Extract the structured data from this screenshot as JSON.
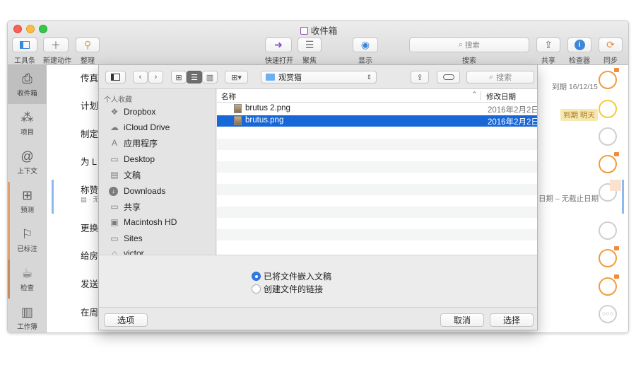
{
  "window": {
    "title": "收件箱"
  },
  "toolbar": {
    "tools_label": "工具条",
    "new_action_label": "新建动作",
    "clean_up_label": "整理",
    "quick_open_label": "快速打开",
    "focus_label": "聚焦",
    "view_label": "显示",
    "search_placeholder": "搜索",
    "search_label": "搜索",
    "share_label": "共享",
    "inspector_label": "检查器",
    "sync_label": "同步"
  },
  "sidebar": {
    "items": [
      {
        "label": "收件箱",
        "icon": "inbox-icon"
      },
      {
        "label": "项目",
        "icon": "projects-icon"
      },
      {
        "label": "上下文",
        "icon": "contexts-icon"
      },
      {
        "label": "预测",
        "icon": "forecast-icon"
      },
      {
        "label": "已标注",
        "icon": "flag-icon"
      },
      {
        "label": "检查",
        "icon": "review-icon"
      },
      {
        "label": "工作簿",
        "icon": "workbook-icon"
      }
    ]
  },
  "tasks": [
    {
      "text": "传真"
    },
    {
      "text": "计划"
    },
    {
      "text": "制定"
    },
    {
      "text": "为 L"
    },
    {
      "text": "称赞",
      "note": "▤ · 无"
    },
    {
      "text": "更换"
    },
    {
      "text": "给房"
    },
    {
      "text": "发送"
    },
    {
      "text": "在周"
    }
  ],
  "task_meta": {
    "due_1": "到期 16/12/15",
    "due_2": "到期 明天",
    "due_5": "日期 – 无截止日期"
  },
  "dialog": {
    "location": "观赏猫",
    "search_placeholder": "搜索",
    "favorites_header": "个人收藏",
    "favorites": [
      {
        "label": "Dropbox",
        "icon": "dropbox-icon"
      },
      {
        "label": "iCloud Drive",
        "icon": "cloud-icon"
      },
      {
        "label": "应用程序",
        "icon": "applications-icon"
      },
      {
        "label": "Desktop",
        "icon": "desktop-icon"
      },
      {
        "label": "文稿",
        "icon": "documents-icon"
      },
      {
        "label": "Downloads",
        "icon": "downloads-icon"
      },
      {
        "label": "共享",
        "icon": "folder-icon"
      },
      {
        "label": "Macintosh HD",
        "icon": "disk-icon"
      },
      {
        "label": "Sites",
        "icon": "folder-icon"
      },
      {
        "label": "victor",
        "icon": "home-icon"
      }
    ],
    "columns": {
      "name": "名称",
      "date": "修改日期"
    },
    "files": [
      {
        "name": "brutus 2.png",
        "date": "2016年2月2日 下",
        "selected": false
      },
      {
        "name": "brutus.png",
        "date": "2016年2月2日",
        "selected": true
      }
    ],
    "options": {
      "embed_label": "已将文件嵌入文稿",
      "link_label": "创建文件的链接",
      "selected": "embed"
    },
    "buttons": {
      "options": "选项",
      "cancel": "取消",
      "choose": "选择"
    }
  }
}
